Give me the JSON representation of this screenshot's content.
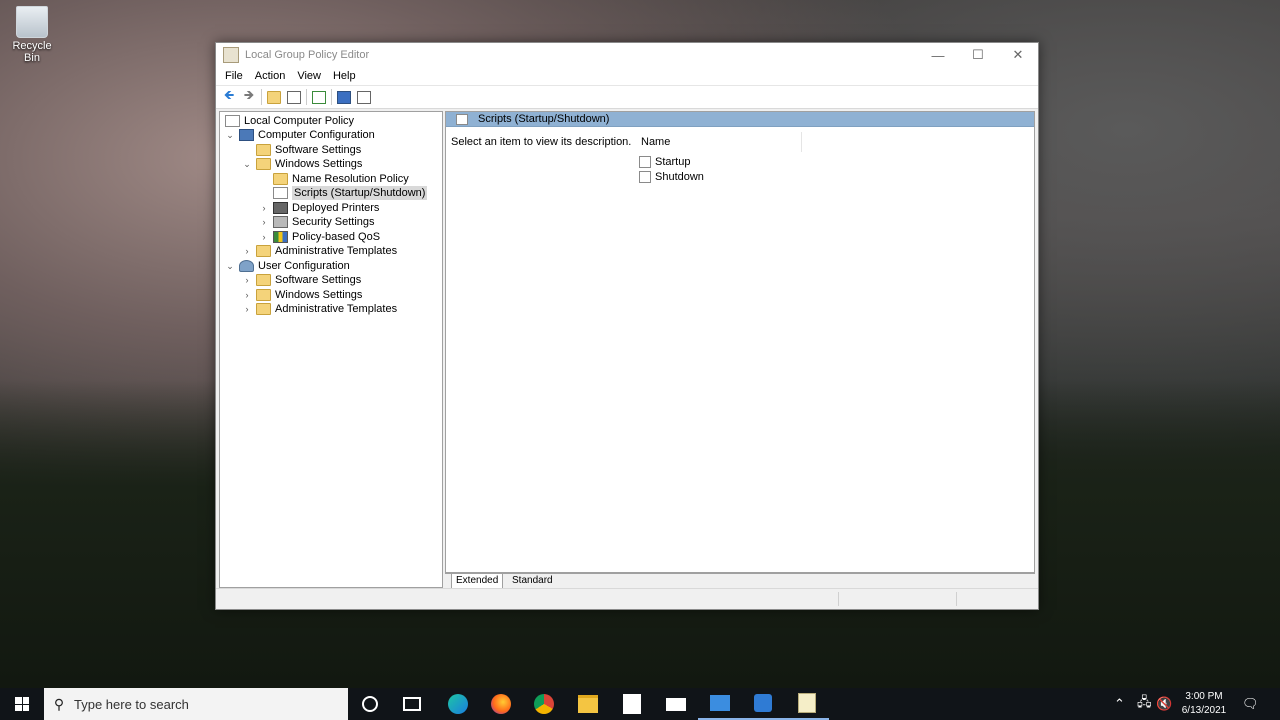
{
  "desktop": {
    "recycle_bin": "Recycle Bin"
  },
  "window": {
    "title": "Local Group Policy Editor",
    "controls": {
      "minimize": "—",
      "maximize": "☐",
      "close": "✕"
    },
    "menu": [
      "File",
      "Action",
      "View",
      "Help"
    ]
  },
  "tree": {
    "root": "Local Computer Policy",
    "computer_config": "Computer Configuration",
    "cc_software": "Software Settings",
    "cc_windows": "Windows Settings",
    "name_resolution": "Name Resolution Policy",
    "scripts": "Scripts (Startup/Shutdown)",
    "printers": "Deployed Printers",
    "security": "Security Settings",
    "qos": "Policy-based QoS",
    "cc_admin": "Administrative Templates",
    "user_config": "User Configuration",
    "uc_software": "Software Settings",
    "uc_windows": "Windows Settings",
    "uc_admin": "Administrative Templates"
  },
  "detail": {
    "header": "Scripts (Startup/Shutdown)",
    "description": "Select an item to view its description.",
    "column_name": "Name",
    "items": [
      "Startup",
      "Shutdown"
    ],
    "tabs": {
      "extended": "Extended",
      "standard": "Standard"
    }
  },
  "taskbar": {
    "search_placeholder": "Type here to search",
    "time": "3:00 PM",
    "date": "6/13/2021"
  }
}
